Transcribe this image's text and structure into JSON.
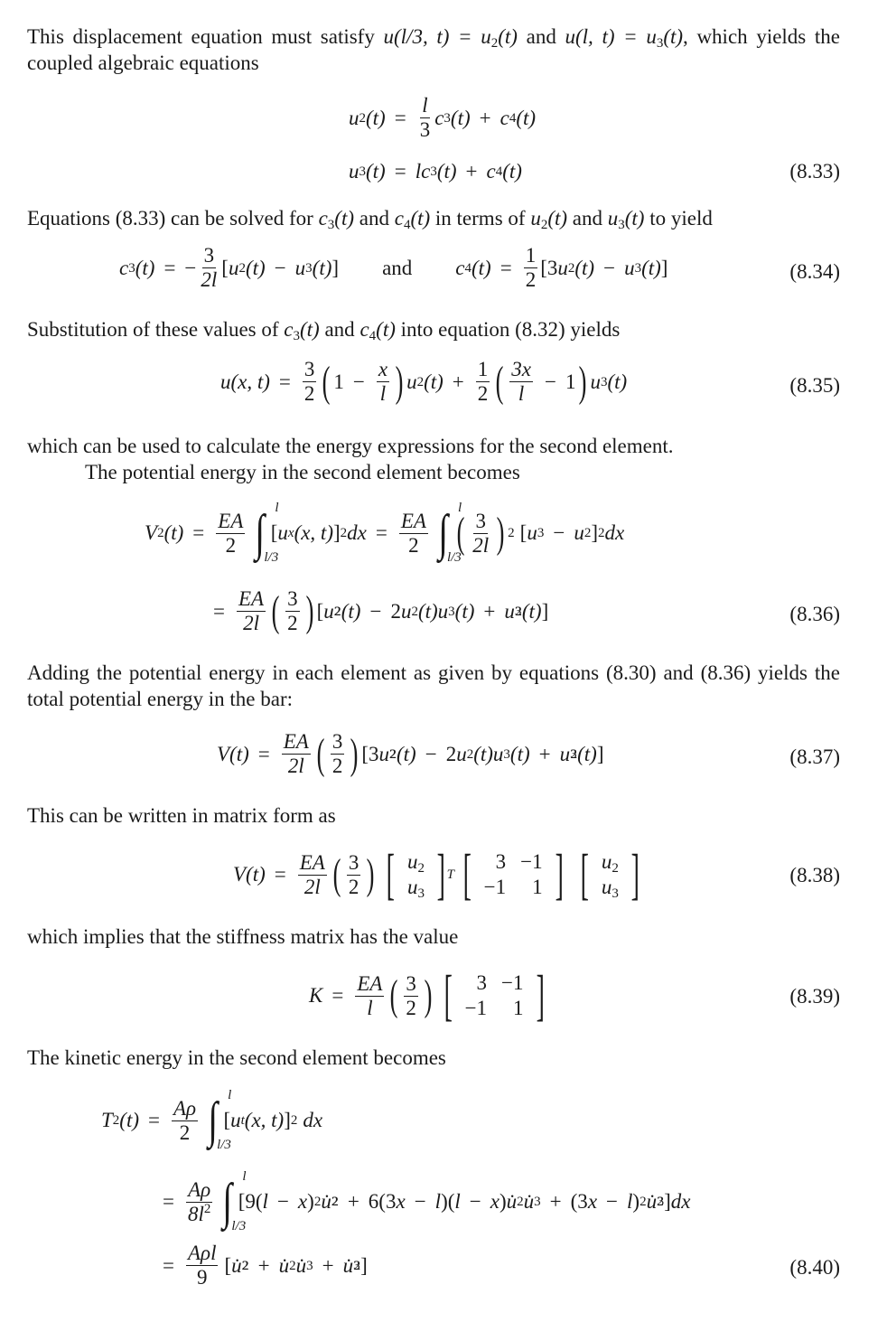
{
  "paragraphs": {
    "p1_a": "This displacement equation must satisfy ",
    "p1_m1": "u(l/3, t) = u",
    "p1_b": " and ",
    "p1_m2": "u(l, t) = u",
    "p1_c": ", which yields the coupled algebraic equations",
    "p2": "Equations (8.33) can be solved for c3(t) and c4(t) in terms of u2(t) and u3(t) to yield",
    "p3": "Substitution of these values of c3(t) and c4(t) into equation (8.32) yields",
    "p4": "which can be used to calculate the energy expressions for the second element.",
    "p5": "The potential energy in the second element becomes",
    "p6": "Adding the potential energy in each element as given by equations (8.30) and (8.36) yields the total potential energy in the bar:",
    "p7": "This can be written in matrix form as",
    "p8": "which implies that the stiffness matrix has the value",
    "p9": "The kinetic energy in the second element becomes"
  },
  "equations": {
    "eq_8_33": {
      "number": "(8.33)",
      "line1": "u2(t) = (l/3) c3(t) + c4(t)",
      "line2": "u3(t) = l c3(t) + c4(t)"
    },
    "eq_8_34": {
      "number": "(8.34)",
      "left": "c3(t) = -(3/2l)[u2(t) - u3(t)]",
      "connector": "and",
      "right": "c4(t) = (1/2)[3u2(t) - u3(t)]"
    },
    "eq_8_35": {
      "number": "(8.35)",
      "text": "u(x,t) = (3/2)(1 - x/l)u2(t) + (1/2)(3x/l - 1)u3(t)"
    },
    "eq_8_36": {
      "number": "(8.36)",
      "line1": "V2(t) = (EA/2)∫_{l/3}^{l}[ux(x,t)]^2 dx = (EA/2)∫_{l/3}^{l}(3/2l)^2[u3 - u2]^2 dx",
      "line2": "= (EA/2l)(3/2)[u2^2(t) - 2u2(t)u3(t) + u3^2(t)]"
    },
    "eq_8_37": {
      "number": "(8.37)",
      "text": "V(t) = (EA/2l)(3/2)[3u2^2(t) - 2u2(t)u3(t) + u3^2(t)]"
    },
    "eq_8_38": {
      "number": "(8.38)",
      "matrix": [
        [
          "3",
          "−1"
        ],
        [
          "−1",
          "1"
        ]
      ],
      "vector": [
        "u2",
        "u3"
      ]
    },
    "eq_8_39": {
      "number": "(8.39)",
      "matrix": [
        [
          "3",
          "−1"
        ],
        [
          "−1",
          "1"
        ]
      ]
    },
    "eq_8_40": {
      "number": "(8.40)",
      "line1": "T2(t) = (Aρ/2)∫_{l/3}^{l}[ut(x,t)]^2 dx",
      "line2": "= (Aρ/8l^2)∫_{l/3}^{l}[9(l - x)^2 u̇2^2 + 6(3x - l)(l - x)u̇2u̇3 + (3x - l)^2 u̇2^3]dx",
      "line3": "= (Aρl/9)[u̇2^2 + u̇2u̇3 + u̇3^2]"
    }
  },
  "symbols": {
    "eq": "=",
    "plus": "+",
    "minus": "−",
    "one": "1",
    "two": "2",
    "three": "3",
    "nine": "9",
    "eight_l2": "8l",
    "two_l": "2l",
    "l": "l",
    "x": "x",
    "three_x": "3x",
    "EA": "EA",
    "Arho": "Aρ",
    "Arhol": "Aρl",
    "T": "T",
    "int_upper": "l",
    "int_lower": "l/3",
    "dx": "dx",
    "and": "and"
  }
}
